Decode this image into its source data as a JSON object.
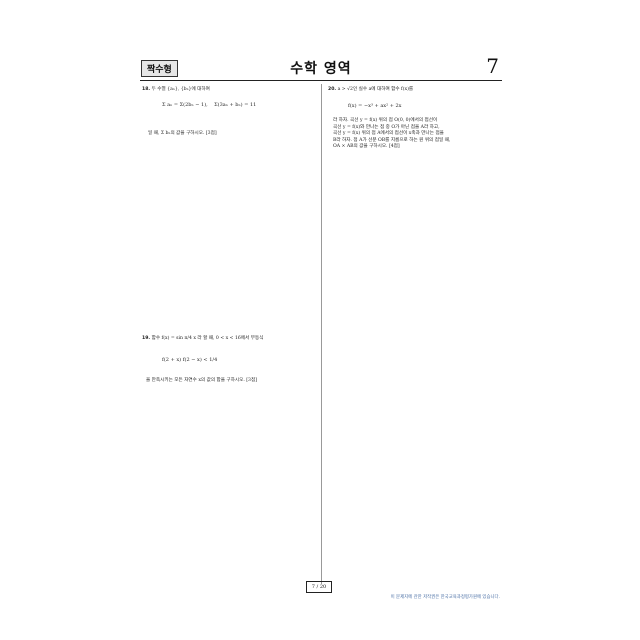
{
  "header": {
    "badge": "짝수형",
    "title": "수학 영역",
    "page_number": "7"
  },
  "questions": {
    "q18": {
      "number": "18.",
      "stem": "두 수열 {aₙ}, {bₙ}에 대하여",
      "eq_left": "Σ aₙ = Σ(2bₙ − 1),",
      "eq_right": "Σ(3aₙ + bₙ) = 11",
      "ask": "일 때, Σ bₙ의 값을 구하시오. [3점]"
    },
    "q19": {
      "number": "19.",
      "stem": "함수 f(x) = sin π/4 x 라 할 때, 0 < x < 16에서 부등식",
      "inequality": "f(2 + x) f(2 − x) < 1/4",
      "ask": "을 만족시키는 모든 자연수 x의 값의 합을 구하시오. [3점]"
    },
    "q20": {
      "number": "20.",
      "stem": "a > √2인 실수 a에 대하여 함수 f(x)를",
      "def": "f(x) = −x³ + ax² + 2x",
      "body_1": "라 하자. 곡선 y = f(x) 위의 점 O(0, 0)에서의 접선이",
      "body_2": "곡선 y = f(x)와 만나는 점 중 O가 아닌 점을 A라 하고,",
      "body_3": "곡선 y = f(x) 위의 점 A에서의 접선이 x축과 만나는 점을",
      "body_4": "B라 하자. 점 A가 선분 OB를 지름으로 하는 원 위의 점일 때,",
      "ask": "OA × AB의 값을 구하시오. [4점]"
    }
  },
  "footer": {
    "page_box": "7 / 20",
    "note": "이 문제지에 관한 저작권은 한국교육과정평가원에 있습니다."
  }
}
